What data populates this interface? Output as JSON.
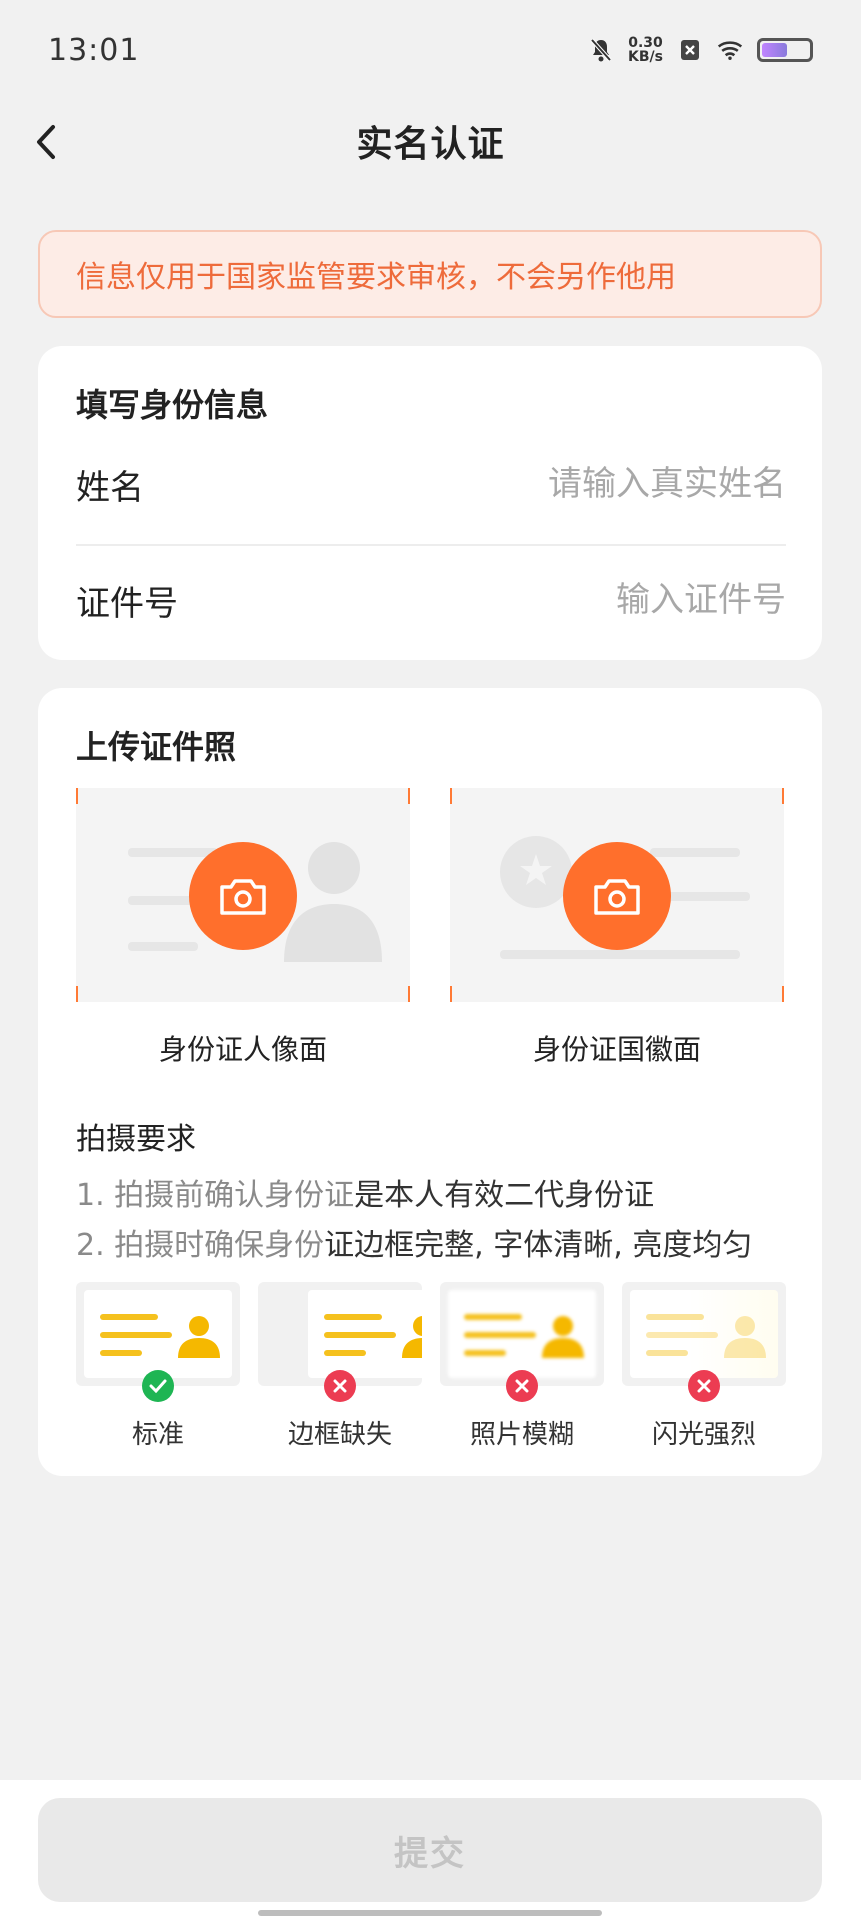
{
  "status_bar": {
    "time": "13:01",
    "net_speed_value": "0.30",
    "net_speed_unit": "KB/s",
    "battery_level": 0.55,
    "icons": [
      "mute-icon",
      "close-box-icon",
      "wifi-icon",
      "battery-icon"
    ]
  },
  "nav": {
    "title": "实名认证",
    "back_icon": "chevron-left-icon"
  },
  "notice": {
    "text": "信息仅用于国家监管要求审核，不会另作他用"
  },
  "identity": {
    "section_title": "填写身份信息",
    "name_label": "姓名",
    "name_value": "",
    "name_placeholder": "请输入真实姓名",
    "id_label": "证件号",
    "id_value": "",
    "id_placeholder": "输入证件号"
  },
  "upload": {
    "section_title": "上传证件照",
    "front_caption": "身份证人像面",
    "back_caption": "身份证国徽面",
    "camera_icon": "camera-icon",
    "accent_color": "#ff6f2c"
  },
  "requirements": {
    "title": "拍摄要求",
    "line1_muted": "1. 拍摄前确认身份证",
    "line1_main": "是本人有效二代身份证",
    "line2_muted": "2. 拍摄时确保身份",
    "line2_main": "证边框完整, 字体清晰, 亮度均匀",
    "samples": [
      {
        "label": "标准",
        "status": "ok"
      },
      {
        "label": "边框缺失",
        "status": "bad"
      },
      {
        "label": "照片模糊",
        "status": "bad"
      },
      {
        "label": "闪光强烈",
        "status": "bad"
      }
    ],
    "ok_color": "#1eb553",
    "bad_color": "#ec3c52"
  },
  "footer": {
    "submit_label": "提交"
  }
}
